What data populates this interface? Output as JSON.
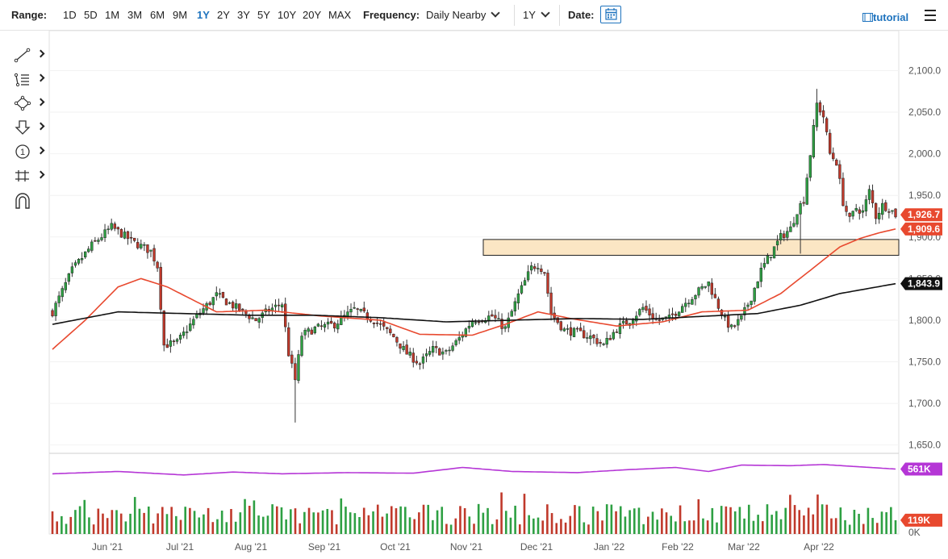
{
  "toolbar": {
    "range_label": "Range:",
    "ranges": [
      "1D",
      "5D",
      "1M",
      "3M",
      "6M",
      "9M",
      "1Y",
      "2Y",
      "3Y",
      "5Y",
      "10Y",
      "20Y",
      "MAX"
    ],
    "active_range": "1Y",
    "frequency_label": "Frequency:",
    "frequency_value": "Daily Nearby",
    "period_value": "1Y",
    "date_label": "Date:",
    "tutorial_label": "tutorial"
  },
  "tools": [
    "trendline-tool-icon",
    "fibonacci-tool-icon",
    "shapes-tool-icon",
    "arrow-tool-icon",
    "annotation-tool-icon",
    "measure-tool-icon",
    "magnet-tool-icon"
  ],
  "tools_text": {
    "annotation_glyph": "1"
  },
  "colors": {
    "up": "#2ea043",
    "down": "#c0392b",
    "ma_fast": "#e8492f",
    "ma_slow": "#111111",
    "volume_ma": "#b536d6",
    "zone_fill": "#fbe6c4",
    "zone_stroke": "#222222",
    "accent": "#1e73be"
  },
  "chart_data": {
    "type": "candlestick",
    "x_labels": [
      "Jun '21",
      "Jul '21",
      "Aug '21",
      "Sep '21",
      "Oct '21",
      "Nov '21",
      "Dec '21",
      "Jan '22",
      "Feb '22",
      "Mar '22",
      "Apr '22"
    ],
    "y_ticks": [
      "2,100.0",
      "2,050.0",
      "2,000.0",
      "1,950.0",
      "1,900.0",
      "1,850.0",
      "1,800.0",
      "1,750.0",
      "1,700.0",
      "1,650.0"
    ],
    "ylim": [
      1640,
      2115
    ],
    "price_badges": [
      {
        "label": "1,926.7",
        "value": 1926.7,
        "color": "#e8492f"
      },
      {
        "label": "1,909.6",
        "value": 1909.6,
        "color": "#e8492f"
      },
      {
        "label": "1,843.9",
        "value": 1843.9,
        "color": "#111111"
      }
    ],
    "zone": {
      "low": 1878,
      "high": 1897
    },
    "anchors": [
      {
        "i": 0,
        "v": 1810
      },
      {
        "i": 6,
        "v": 1860
      },
      {
        "i": 12,
        "v": 1890
      },
      {
        "i": 18,
        "v": 1912
      },
      {
        "i": 25,
        "v": 1893
      },
      {
        "i": 30,
        "v": 1883
      },
      {
        "i": 32,
        "v": 1865
      },
      {
        "i": 34,
        "v": 1770
      },
      {
        "i": 38,
        "v": 1773
      },
      {
        "i": 44,
        "v": 1805
      },
      {
        "i": 50,
        "v": 1830
      },
      {
        "i": 56,
        "v": 1815
      },
      {
        "i": 62,
        "v": 1800
      },
      {
        "i": 66,
        "v": 1812
      },
      {
        "i": 70,
        "v": 1820
      },
      {
        "i": 72,
        "v": 1760
      },
      {
        "i": 74,
        "v": 1728
      },
      {
        "i": 76,
        "v": 1782
      },
      {
        "i": 80,
        "v": 1790
      },
      {
        "i": 86,
        "v": 1795
      },
      {
        "i": 92,
        "v": 1813
      },
      {
        "i": 98,
        "v": 1800
      },
      {
        "i": 104,
        "v": 1780
      },
      {
        "i": 108,
        "v": 1760
      },
      {
        "i": 112,
        "v": 1748
      },
      {
        "i": 116,
        "v": 1765
      },
      {
        "i": 120,
        "v": 1760
      },
      {
        "i": 124,
        "v": 1778
      },
      {
        "i": 128,
        "v": 1800
      },
      {
        "i": 134,
        "v": 1805
      },
      {
        "i": 138,
        "v": 1790
      },
      {
        "i": 142,
        "v": 1830
      },
      {
        "i": 146,
        "v": 1863
      },
      {
        "i": 148,
        "v": 1867
      },
      {
        "i": 150,
        "v": 1858
      },
      {
        "i": 152,
        "v": 1808
      },
      {
        "i": 156,
        "v": 1788
      },
      {
        "i": 160,
        "v": 1785
      },
      {
        "i": 164,
        "v": 1780
      },
      {
        "i": 168,
        "v": 1770
      },
      {
        "i": 172,
        "v": 1790
      },
      {
        "i": 176,
        "v": 1800
      },
      {
        "i": 180,
        "v": 1815
      },
      {
        "i": 184,
        "v": 1800
      },
      {
        "i": 188,
        "v": 1802
      },
      {
        "i": 192,
        "v": 1818
      },
      {
        "i": 196,
        "v": 1832
      },
      {
        "i": 200,
        "v": 1845
      },
      {
        "i": 202,
        "v": 1825
      },
      {
        "i": 205,
        "v": 1800
      },
      {
        "i": 207,
        "v": 1790
      },
      {
        "i": 210,
        "v": 1802
      },
      {
        "i": 213,
        "v": 1828
      },
      {
        "i": 216,
        "v": 1860
      },
      {
        "i": 219,
        "v": 1880
      },
      {
        "i": 222,
        "v": 1900
      },
      {
        "i": 225,
        "v": 1910
      },
      {
        "i": 227,
        "v": 1932
      },
      {
        "i": 229,
        "v": 1945
      },
      {
        "i": 231,
        "v": 2000
      },
      {
        "i": 233,
        "v": 2060
      },
      {
        "i": 235,
        "v": 2045
      },
      {
        "i": 237,
        "v": 2000
      },
      {
        "i": 239,
        "v": 1990
      },
      {
        "i": 241,
        "v": 1942
      },
      {
        "i": 243,
        "v": 1920
      },
      {
        "i": 245,
        "v": 1935
      },
      {
        "i": 247,
        "v": 1930
      },
      {
        "i": 249,
        "v": 1955
      },
      {
        "i": 251,
        "v": 1925
      },
      {
        "i": 253,
        "v": 1938
      },
      {
        "i": 255,
        "v": 1935
      },
      {
        "i": 257,
        "v": 1927
      }
    ],
    "ma_fast_anchors": [
      {
        "i": 0,
        "v": 1765
      },
      {
        "i": 10,
        "v": 1800
      },
      {
        "i": 20,
        "v": 1840
      },
      {
        "i": 27,
        "v": 1850
      },
      {
        "i": 35,
        "v": 1840
      },
      {
        "i": 50,
        "v": 1810
      },
      {
        "i": 65,
        "v": 1812
      },
      {
        "i": 82,
        "v": 1805
      },
      {
        "i": 100,
        "v": 1800
      },
      {
        "i": 112,
        "v": 1783
      },
      {
        "i": 128,
        "v": 1782
      },
      {
        "i": 138,
        "v": 1795
      },
      {
        "i": 148,
        "v": 1810
      },
      {
        "i": 158,
        "v": 1802
      },
      {
        "i": 172,
        "v": 1793
      },
      {
        "i": 186,
        "v": 1798
      },
      {
        "i": 198,
        "v": 1810
      },
      {
        "i": 212,
        "v": 1812
      },
      {
        "i": 222,
        "v": 1832
      },
      {
        "i": 232,
        "v": 1863
      },
      {
        "i": 240,
        "v": 1888
      },
      {
        "i": 246,
        "v": 1898
      },
      {
        "i": 252,
        "v": 1905
      },
      {
        "i": 257,
        "v": 1909.6
      }
    ],
    "ma_slow_anchors": [
      {
        "i": 0,
        "v": 1795
      },
      {
        "i": 20,
        "v": 1810
      },
      {
        "i": 40,
        "v": 1808
      },
      {
        "i": 60,
        "v": 1806
      },
      {
        "i": 80,
        "v": 1806
      },
      {
        "i": 100,
        "v": 1803
      },
      {
        "i": 120,
        "v": 1798
      },
      {
        "i": 140,
        "v": 1800
      },
      {
        "i": 160,
        "v": 1802
      },
      {
        "i": 180,
        "v": 1801
      },
      {
        "i": 200,
        "v": 1805
      },
      {
        "i": 215,
        "v": 1808
      },
      {
        "i": 228,
        "v": 1818
      },
      {
        "i": 240,
        "v": 1832
      },
      {
        "i": 257,
        "v": 1843.9
      }
    ],
    "volume": {
      "count": 185,
      "ylim": [
        0,
        620
      ],
      "badges": [
        {
          "label": "561K",
          "value": 561,
          "color": "#b536d6"
        },
        {
          "label": "119K",
          "value": 119,
          "color": "#e8492f"
        }
      ],
      "zero_label": "0K",
      "ma_anchors": [
        {
          "i": 0,
          "v": 520
        },
        {
          "i": 20,
          "v": 540
        },
        {
          "i": 40,
          "v": 510
        },
        {
          "i": 55,
          "v": 535
        },
        {
          "i": 70,
          "v": 520
        },
        {
          "i": 90,
          "v": 530
        },
        {
          "i": 110,
          "v": 525
        },
        {
          "i": 125,
          "v": 575
        },
        {
          "i": 140,
          "v": 540
        },
        {
          "i": 160,
          "v": 530
        },
        {
          "i": 175,
          "v": 555
        },
        {
          "i": 190,
          "v": 575
        },
        {
          "i": 200,
          "v": 540
        },
        {
          "i": 210,
          "v": 595
        },
        {
          "i": 225,
          "v": 590
        },
        {
          "i": 235,
          "v": 600
        },
        {
          "i": 257,
          "v": 561
        }
      ]
    }
  }
}
